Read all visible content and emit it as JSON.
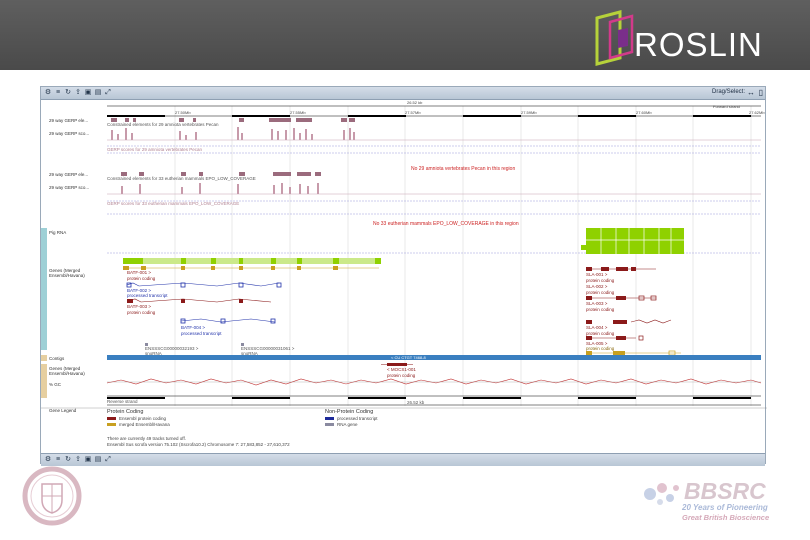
{
  "header": {
    "logo_text": "ROSLIN"
  },
  "toolbar": {
    "icons": [
      "gear-icon",
      "sliders-icon",
      "refresh-icon",
      "export-icon",
      "image-icon",
      "save-icon",
      "resize-icon"
    ],
    "drag_select_label": "Drag/Select:"
  },
  "scale": {
    "total_length": "26.52 kb",
    "forward_strand": "Forward strand",
    "reverse_strand": "Reverse strand",
    "ticks_top": [
      "27.50Mb",
      "27.55Mb",
      "27.57Mb",
      "27.58Mb",
      "27.59Mb",
      "27.60Mb",
      "27.61Mb",
      "27.62Mb"
    ],
    "ticks_bottom": [
      "27.58Mb",
      "27.55Mb",
      "27.57Mb",
      "27.58Mb",
      "27.59Mb",
      "27.60Mb",
      "27.61Mb",
      "27.62Mb"
    ]
  },
  "tracks": {
    "gerp1_label": "29 way GERP ele...",
    "gerp1b_label": "29 way GERP sco...",
    "gerp1_desc": "Constrained elements for 29 amniota vertebrates Pecan",
    "gerp1_sub": "GERP scores for 29 amniota vertebrates Pecan",
    "gerp2_label": "29 way GERP ele...",
    "gerp2b_label": "29 way GERP sco...",
    "gerp2_desc": "Constrained elements for 33 eutherian mammals EPO_LOW_COVERAGE",
    "gerp2_sub": "GERP scores for 33 eutherian mammals EPO_LOW_COVERAGE",
    "note1": "No 29 amniota vertebrates Pecan in this region",
    "note2": "No 33 eutherian mammals EPO_LOW_COVERAGE in this region",
    "rnaseq_label": "Pig RNA",
    "genes_label": "Genes (Merged Ensembl/Havana)",
    "contigs_label": "Contigs",
    "genes_rev_label": "Genes (Merged Ensembl/Havana)",
    "gc_label": "% GC",
    "seq_label": "Gene Legend",
    "contig_text": "< CU  CTGT 7468-8"
  },
  "transcripts": [
    {
      "name": "BATF-001 >",
      "type": "protein coding"
    },
    {
      "name": "BATF-002 >",
      "type": "processed transcript"
    },
    {
      "name": "BATF-003 >",
      "type": "protein coding"
    },
    {
      "name": "BATF-004 >",
      "type": "processed transcript"
    },
    {
      "name": "SLA-001 >",
      "type": "protein coding"
    },
    {
      "name": "SLA-002 >",
      "type": "protein coding"
    },
    {
      "name": "SLA-003 >",
      "type": "protein coding"
    },
    {
      "name": "SLA-004 >",
      "type": "protein coding"
    },
    {
      "name": "SLA-005 >",
      "type": "protein coding"
    }
  ],
  "small_labels": [
    "ENSSSCG00000032193 >",
    "snoRNA",
    "ENSSSCG00000031061 >",
    "snoRNA"
  ],
  "rev_gene": {
    "name": "< MOCS1-001",
    "type": "protein coding"
  },
  "legend": {
    "protein_title": "Protein Coding",
    "protein_items": [
      {
        "label": "Ensembl protein coding",
        "color": "#8b1a1a"
      },
      {
        "label": "merged Ensembl/Havana",
        "color": "#c8a020"
      }
    ],
    "nonprotein_title": "Non-Protein Coding",
    "nonprotein_items": [
      {
        "label": "processed transcript",
        "color": "#1e2a9a"
      },
      {
        "label": "RNA gene",
        "color": "#8a8aa0"
      }
    ],
    "footer1": "There are currently 49 tracks turned off.",
    "footer2": "Ensembl Sus scrofa version 75.102 (Sscrofa10.2) Chromosome 7: 27,583,852 - 27,610,372"
  },
  "bbsrc": {
    "name": "BBSRC",
    "tag1": "20 Years of Pioneering",
    "tag2": "Great British Bioscience"
  },
  "colors": {
    "header_bg": "#555555",
    "gerp_bar": "#9b6b7d",
    "green": "#8fd100",
    "dark_red": "#8b1a1a",
    "blue": "#2233aa",
    "contig_blue": "#3a7fc0"
  }
}
